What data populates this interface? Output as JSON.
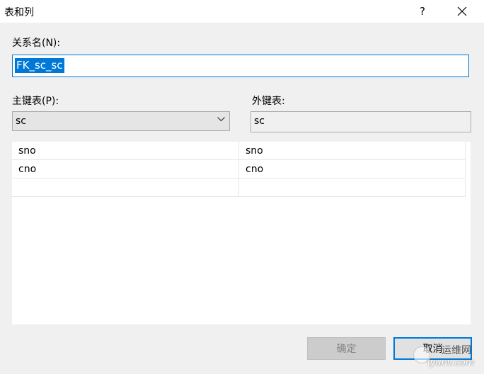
{
  "window": {
    "title": "表和列",
    "help": "?"
  },
  "relation_name": {
    "label": "关系名(N):",
    "value": "FK_sc_sc"
  },
  "primary_table": {
    "label": "主键表(P):",
    "value": "sc"
  },
  "foreign_table": {
    "label": "外键表:",
    "value": "sc"
  },
  "columns": {
    "rows": [
      {
        "primary": "sno",
        "foreign": "sno"
      },
      {
        "primary": "cno",
        "foreign": "cno"
      },
      {
        "primary": "",
        "foreign": ""
      }
    ]
  },
  "buttons": {
    "ok": "确定",
    "cancel": "取消"
  },
  "watermark": {
    "text": "运维网",
    "url": "iyunv.com"
  }
}
